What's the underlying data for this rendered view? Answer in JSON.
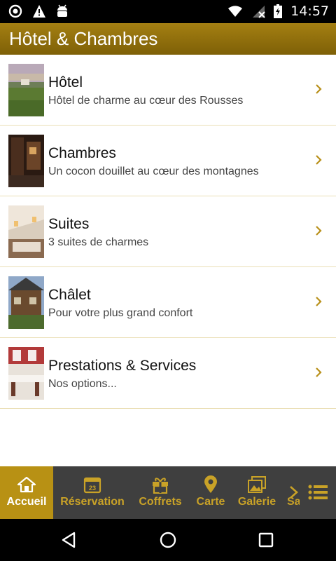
{
  "status_bar": {
    "time": "14:57",
    "icons": [
      "circle-notification-icon",
      "warning-icon",
      "android-icon",
      "wifi-icon",
      "no-sim-icon",
      "battery-icon"
    ]
  },
  "header": {
    "title": "Hôtel & Chambres"
  },
  "list": {
    "items": [
      {
        "title": "Hôtel",
        "subtitle": "Hôtel de charme au cœur des Rousses"
      },
      {
        "title": "Chambres",
        "subtitle": "Un cocon douillet au cœur des montagnes"
      },
      {
        "title": "Suites",
        "subtitle": "3 suites de charmes"
      },
      {
        "title": "Châlet",
        "subtitle": "Pour votre plus grand confort"
      },
      {
        "title": "Prestations & Services",
        "subtitle": "Nos options..."
      }
    ]
  },
  "tabs": {
    "items": [
      {
        "label": "Accueil",
        "icon": "home-icon",
        "active": true
      },
      {
        "label": "Réservation",
        "icon": "calendar-icon",
        "calendar_day": "23"
      },
      {
        "label": "Coffrets",
        "icon": "gift-icon"
      },
      {
        "label": "Carte",
        "icon": "map-pin-icon"
      },
      {
        "label": "Galerie",
        "icon": "gallery-icon"
      },
      {
        "label": "Sa",
        "icon": ""
      }
    ]
  },
  "colors": {
    "accent": "#b89114",
    "header_top": "#a47f12",
    "header_bottom": "#7e6007",
    "tab_bar": "#3f3f3f",
    "tab_text": "#c9a227",
    "divider": "#eadfb6"
  }
}
